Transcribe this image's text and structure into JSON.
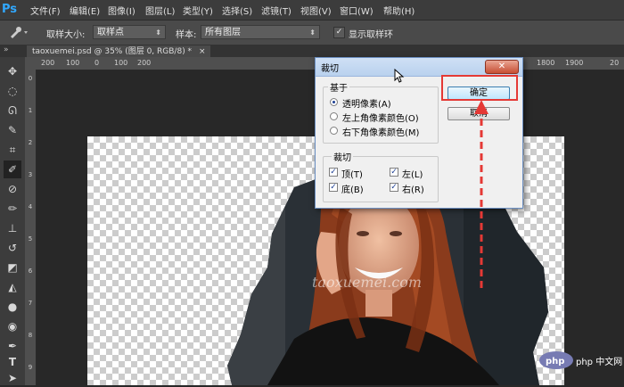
{
  "app_logo": "Ps",
  "menu": [
    "文件(F)",
    "编辑(E)",
    "图像(I)",
    "图层(L)",
    "类型(Y)",
    "选择(S)",
    "滤镜(T)",
    "视图(V)",
    "窗口(W)",
    "帮助(H)"
  ],
  "options_bar": {
    "sample_size_label": "取样大小:",
    "sample_size_value": "取样点",
    "sample_label": "样本:",
    "sample_value": "所有图层",
    "show_ring_label": "显示取样环",
    "show_ring_checked": true
  },
  "document_tab": "taoxuemei.psd @ 35% (图层 0, RGB/8) *",
  "document_tab_close": "×",
  "ruler_h": [
    "200",
    "100",
    "0",
    "100",
    "200",
    "1800",
    "1900",
    "20"
  ],
  "ruler_v": [
    "0",
    "1",
    "2",
    "3",
    "4",
    "5",
    "6",
    "7",
    "8",
    "9"
  ],
  "dialog": {
    "title": "裁切",
    "close": "✕",
    "basis_group": "基于",
    "basis_options": [
      "透明像素(A)",
      "左上角像素颜色(O)",
      "右下角像素颜色(M)"
    ],
    "basis_selected": 0,
    "trim_group": "裁切",
    "trim_options": [
      {
        "label": "顶(T)",
        "checked": true
      },
      {
        "label": "左(L)",
        "checked": true
      },
      {
        "label": "底(B)",
        "checked": true
      },
      {
        "label": "右(R)",
        "checked": true
      }
    ],
    "ok": "确定",
    "cancel": "取消"
  },
  "watermark": "taoxuemei.com",
  "brand_watermark": "php 中文网",
  "colors": {
    "highlight": "#e53935",
    "ps_blue": "#31a8ff"
  }
}
